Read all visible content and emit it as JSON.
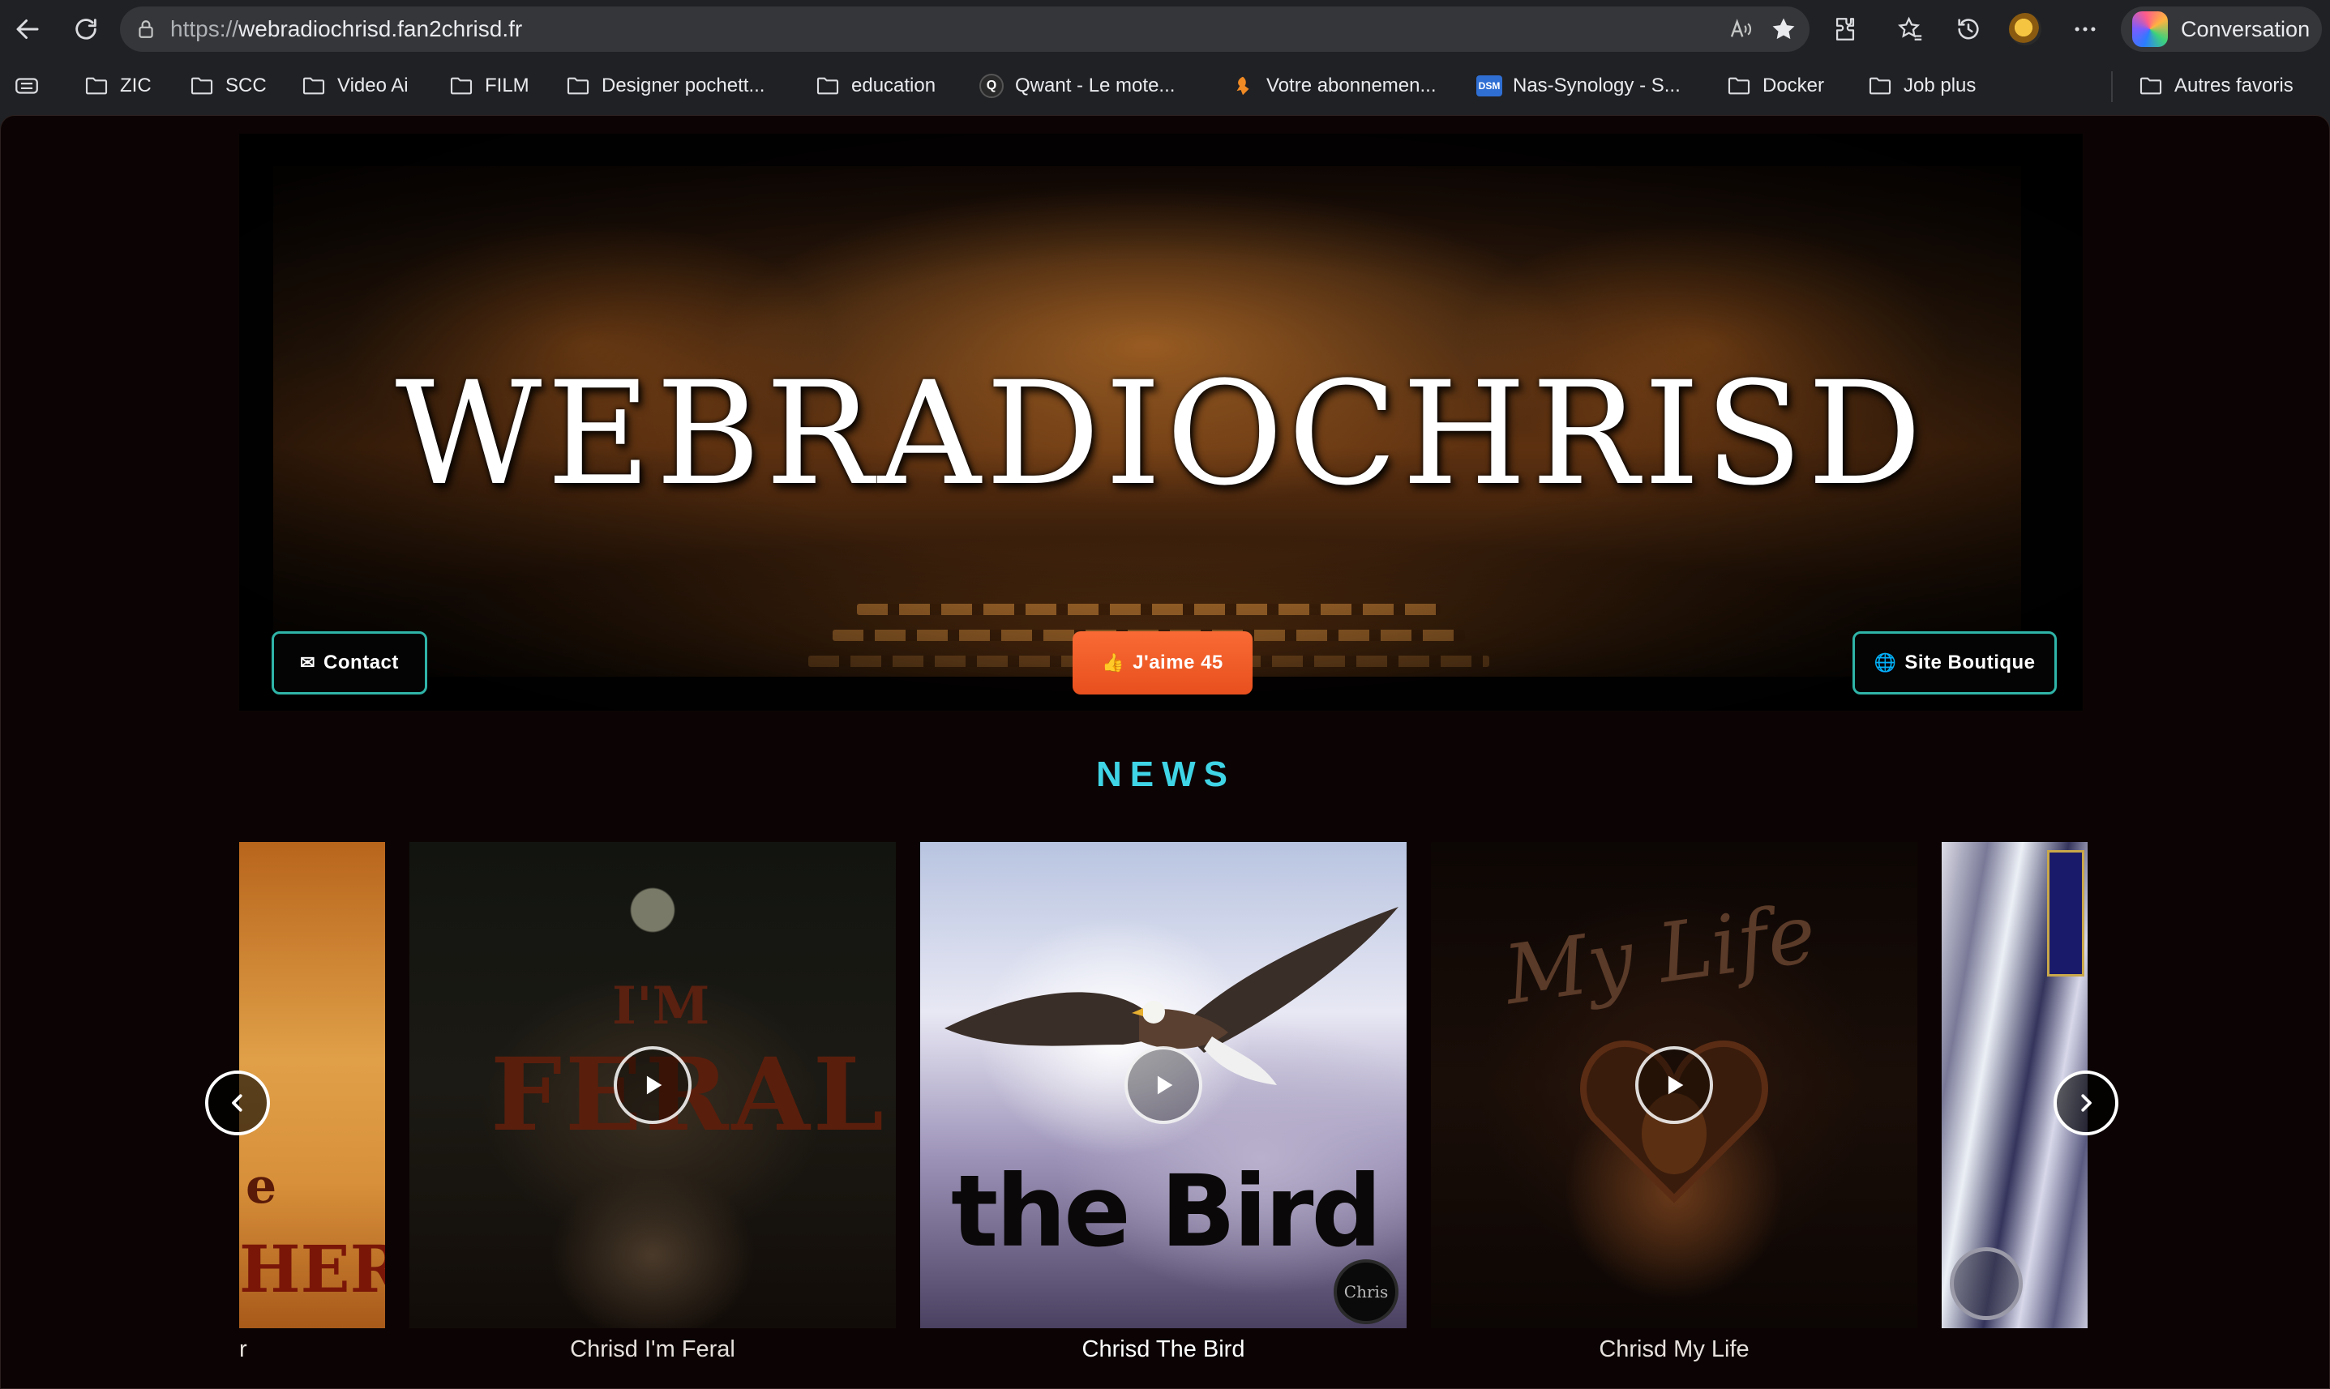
{
  "browser": {
    "url_scheme": "https://",
    "url_host": "webradiochrisd.fan2chrisd.fr",
    "conversation_label": "Conversation",
    "bookmarks": [
      {
        "label": "ZIC",
        "icon": "folder-icon"
      },
      {
        "label": "SCC",
        "icon": "folder-icon"
      },
      {
        "label": "Video Ai",
        "icon": "folder-icon"
      },
      {
        "label": "FILM",
        "icon": "folder-icon"
      },
      {
        "label": "Designer pochett...",
        "icon": "folder-icon"
      },
      {
        "label": "education",
        "icon": "folder-icon"
      },
      {
        "label": "Qwant - Le mote...",
        "icon": "qwant-icon"
      },
      {
        "label": "Votre abonnemen...",
        "icon": "site-icon"
      },
      {
        "label": "Nas-Synology - S...",
        "icon": "dsm-icon"
      },
      {
        "label": "Docker",
        "icon": "folder-icon"
      },
      {
        "label": "Job plus",
        "icon": "folder-icon"
      }
    ],
    "other_favorites": "Autres favoris",
    "dsm_badge": "DSM",
    "qwant_badge": "Q"
  },
  "page": {
    "hero_title": "WEBRADIOCHRISD",
    "contact_label": "Contact",
    "like_label": "J'aime 45",
    "shop_label": "Site Boutique",
    "news_heading": "NEWS",
    "cards": [
      {
        "caption": "r",
        "cover_text_1": "e",
        "cover_text_2": "HER"
      },
      {
        "caption": "Chrisd I'm Feral",
        "cover_text_1": "I'M",
        "cover_text_2": "FERAL"
      },
      {
        "caption": "Chrisd The Bird",
        "cover_text_1": "the Bird",
        "cover_text_2": "Chris"
      },
      {
        "caption": "Chrisd My Life",
        "cover_text_1": "My Life"
      },
      {
        "caption": ""
      }
    ],
    "accent_color": "#3fd4e6",
    "like_color": "#f96a34",
    "outline_color": "#2fb4a8"
  }
}
